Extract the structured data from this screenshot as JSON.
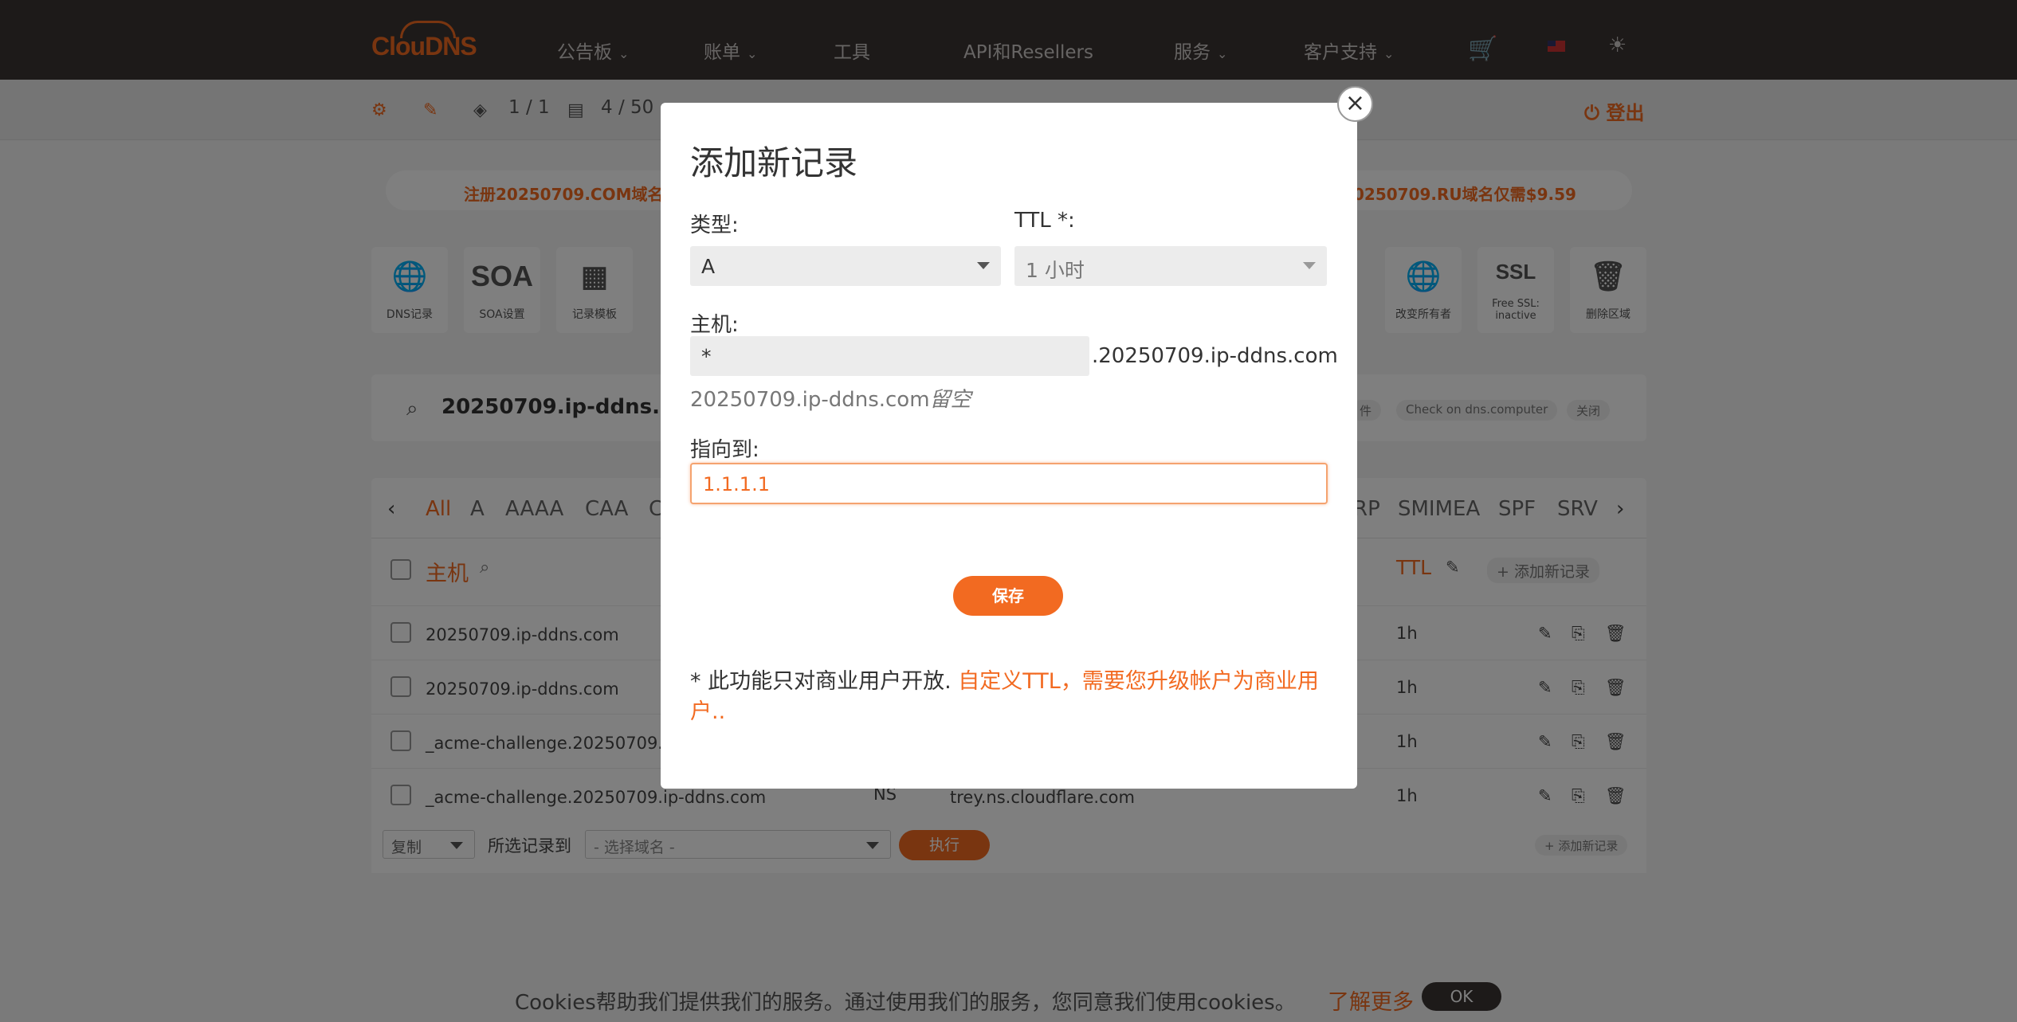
{
  "nav": {
    "logo": "ClouDNS",
    "items": [
      "公告板",
      "账单",
      "工具",
      "API和Resellers",
      "服务",
      "客户支持"
    ]
  },
  "secbar": {
    "zones_count": "1 / 1",
    "records_count": "4 / 50",
    "logout": "登出"
  },
  "promo": {
    "left": "注册20250709.COM域名仅需",
    "right": "0250709.RU域名仅需$9.59"
  },
  "tools": [
    {
      "label": "DNS记录",
      "glyph": "globe-icon"
    },
    {
      "label": "SOA设置",
      "glyph": "SOA"
    },
    {
      "label": "记录模板",
      "glyph": "template-icon"
    },
    {
      "label": "改变所有者",
      "glyph": "transfer-icon"
    },
    {
      "label": "Free SSL: inactive",
      "glyph": "SSL"
    },
    {
      "label": "删除区域",
      "glyph": "trash-icon"
    }
  ],
  "domainbar": {
    "domain": "20250709.ip-ddns.com",
    "chips": [
      "件",
      "Check on dns.computer",
      "关闭"
    ]
  },
  "tabs": [
    "All",
    "A",
    "AAAA",
    "CAA",
    "C",
    "RP",
    "SMIMEA",
    "SPF",
    "SRV"
  ],
  "list": {
    "header_host": "主机",
    "header_ttl": "TTL",
    "add_label": "+ 添加新记录",
    "rows": [
      {
        "host": "20250709.ip-ddns.com",
        "ttl": "1h"
      },
      {
        "host": "20250709.ip-ddns.com",
        "ttl": "1h"
      },
      {
        "host": "_acme-challenge.20250709.ip",
        "ttl": "1h"
      },
      {
        "host": "_acme-challenge.20250709.ip-ddns.com",
        "type": "NS",
        "value": "trey.ns.cloudflare.com",
        "ttl": "1h"
      }
    ],
    "bulk_copy": "复制",
    "bulk_to": "所选记录到",
    "bulk_select": "- 选择域名 -",
    "bulk_exec": "执行",
    "bulk_add": "+ 添加新记录"
  },
  "modal": {
    "title": "添加新记录",
    "type_label": "类型:",
    "type_value": "A",
    "ttl_label": "TTL *:",
    "ttl_value": "1 小时",
    "host_label": "主机:",
    "host_value": "*",
    "host_suffix": ".20250709.ip-ddns.com",
    "hint_domain": "20250709.ip-ddns.com",
    "hint_empty": "留空",
    "points_label": "指向到:",
    "points_value": "1.1.1.1",
    "save": "保存",
    "note_prefix": "* 此功能只对商业用户开放.",
    "note_link": "自定义TTL，需要您升级帐户为商业用户..",
    "close": "×"
  },
  "cookie": {
    "text": "Cookies帮助我们提供我们的服务。通过使用我们的服务，您同意我们使用cookies。",
    "link": "了解更多",
    "ok": "OK"
  },
  "colors": {
    "accent": "#f26a21",
    "nav_bg": "#3a3433"
  }
}
